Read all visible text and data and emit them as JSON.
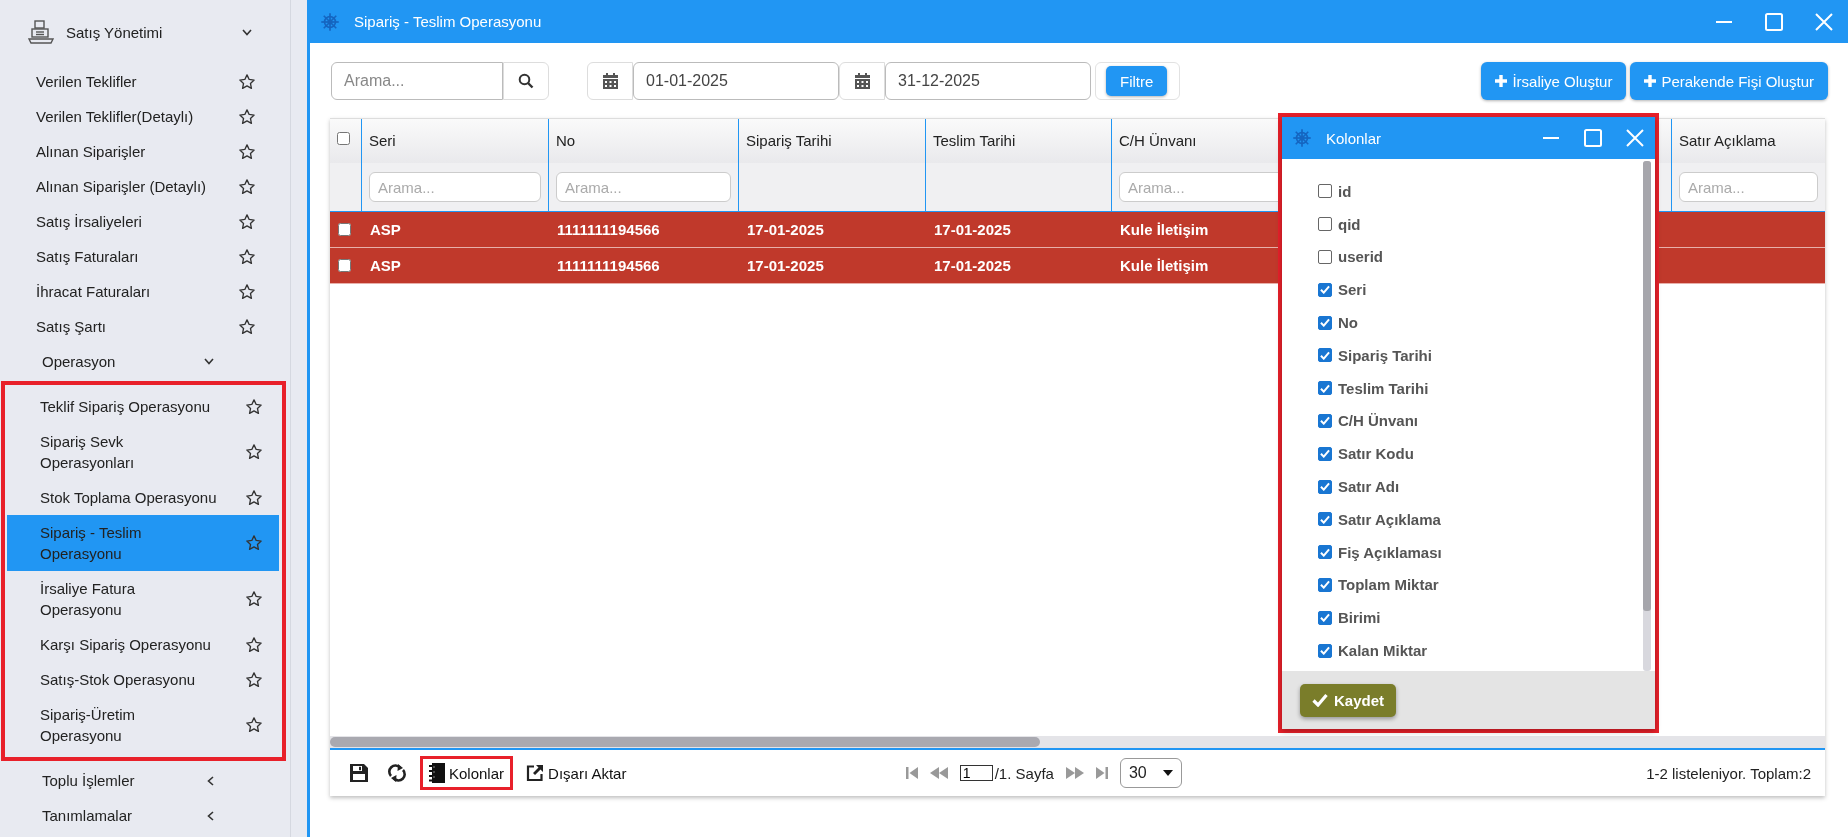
{
  "sidebar": {
    "module": {
      "title": "Satış Yönetimi",
      "expanded": true
    },
    "items": [
      {
        "label": "Verilen Teklifler",
        "selected": false
      },
      {
        "label": "Verilen Teklifler(Detaylı)",
        "selected": false
      },
      {
        "label": "Alınan Siparişler",
        "selected": false
      },
      {
        "label": "Alınan Siparişler (Detaylı)",
        "selected": false
      },
      {
        "label": "Satış İrsaliyeleri",
        "selected": false
      },
      {
        "label": "Satış Faturaları",
        "selected": false
      },
      {
        "label": "İhracat Faturaları",
        "selected": false
      },
      {
        "label": "Satış Şartı",
        "selected": false
      }
    ],
    "submenus": [
      {
        "label": "Operasyon",
        "expanded": true,
        "highlighted": true,
        "items": [
          {
            "label": "Teklif Sipariş Operasyonu",
            "selected": false
          },
          {
            "label": "Sipariş Sevk Operasyonları",
            "selected": false
          },
          {
            "label": "Stok Toplama Operasyonu",
            "selected": false
          },
          {
            "label": "Sipariş - Teslim Operasyonu",
            "selected": true
          },
          {
            "label": "İrsaliye Fatura Operasyonu",
            "selected": false
          },
          {
            "label": "Karşı Sipariş Operasyonu",
            "selected": false
          },
          {
            "label": "Satış-Stok Operasyonu",
            "selected": false
          },
          {
            "label": "Sipariş-Üretim Operasyonu",
            "selected": false
          }
        ]
      },
      {
        "label": "Toplu İşlemler",
        "expanded": false
      },
      {
        "label": "Tanımlamalar",
        "expanded": false
      }
    ]
  },
  "window": {
    "title": "Sipariş - Teslim Operasyonu"
  },
  "toolbar": {
    "search": {
      "placeholder": "Arama..."
    },
    "date_from": "01-01-2025",
    "date_to": "31-12-2025",
    "filter_button": "Filtre",
    "actions": [
      "İrsaliye Oluştur",
      "Perakende Fişi Oluştur"
    ]
  },
  "table": {
    "select_all": {
      "checked": false
    },
    "columns": [
      {
        "label": "Seri",
        "filter_placeholder": "Arama..."
      },
      {
        "label": "No",
        "filter_placeholder": "Arama..."
      },
      {
        "label": "Sipariş Tarihi"
      },
      {
        "label": "Teslim Tarihi"
      },
      {
        "label": "C/H Ünvanı",
        "filter_placeholder": "Arama..."
      },
      {
        "label": "Satır Açıklama",
        "filter_placeholder": "Arama..."
      }
    ],
    "rows": [
      {
        "checked": false,
        "cells": [
          "ASP",
          "1111111194566",
          "17-01-2025",
          "17-01-2025",
          "Kule İletişim"
        ]
      },
      {
        "checked": false,
        "cells": [
          "ASP",
          "1111111194566",
          "17-01-2025",
          "17-01-2025",
          "Kule İletişim"
        ]
      }
    ]
  },
  "footer": {
    "columns_button": {
      "label": "Kolonlar",
      "highlighted": true
    },
    "export_button": "Dışarı Aktar",
    "page": "1",
    "page_label": "/1. Sayfa",
    "page_size": "30",
    "status": "1-2 listeleniyor. Toplam:2"
  },
  "columns_dialog": {
    "title": "Kolonlar",
    "highlighted": true,
    "save_button": "Kaydet",
    "items": [
      {
        "label": "id",
        "checked": false
      },
      {
        "label": "qid",
        "checked": false
      },
      {
        "label": "userid",
        "checked": false
      },
      {
        "label": "Seri",
        "checked": true
      },
      {
        "label": "No",
        "checked": true
      },
      {
        "label": "Sipariş Tarihi",
        "checked": true
      },
      {
        "label": "Teslim Tarihi",
        "checked": true
      },
      {
        "label": "C/H Ünvanı",
        "checked": true
      },
      {
        "label": "Satır Kodu",
        "checked": true
      },
      {
        "label": "Satır Adı",
        "checked": true
      },
      {
        "label": "Satır Açıklama",
        "checked": true
      },
      {
        "label": "Fiş Açıklaması",
        "checked": true
      },
      {
        "label": "Toplam Miktar",
        "checked": true
      },
      {
        "label": "Birimi",
        "checked": true
      },
      {
        "label": "Kalan Miktar",
        "checked": true
      }
    ]
  }
}
